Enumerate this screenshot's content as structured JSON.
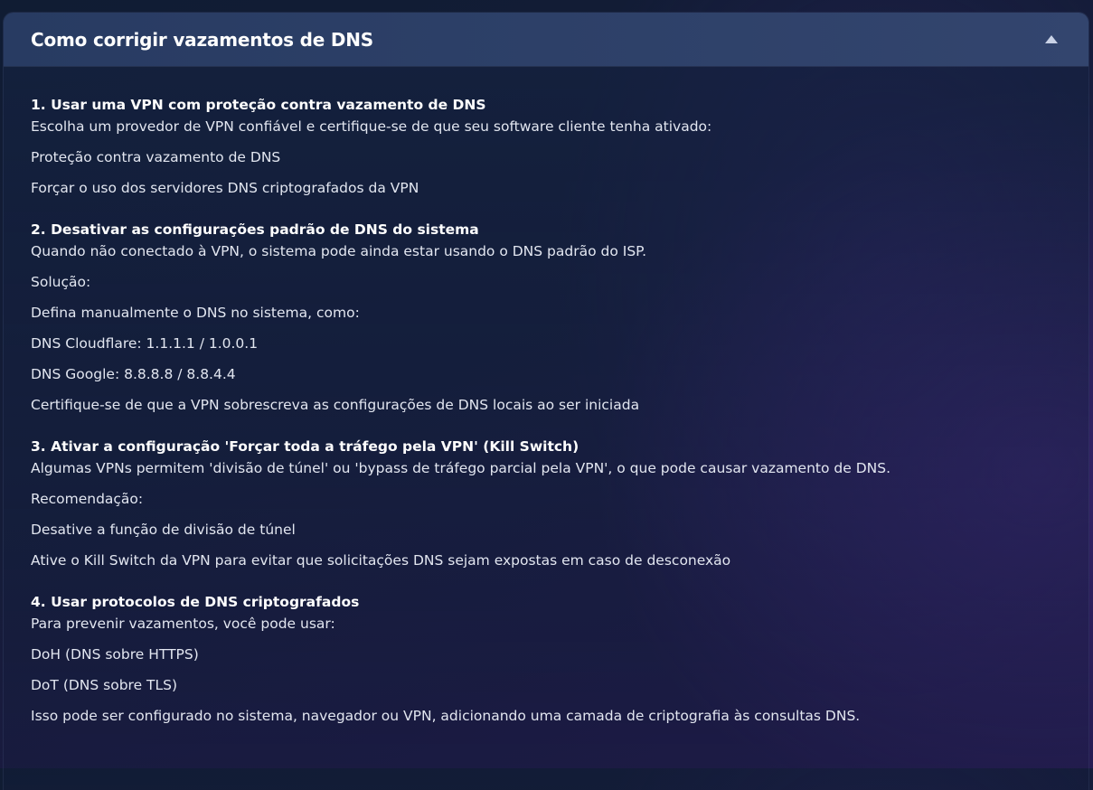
{
  "panel": {
    "title": "Como corrigir vazamentos de DNS"
  },
  "sections": [
    {
      "title": "1. Usar uma VPN com proteção contra vazamento de DNS",
      "lines": [
        "Escolha um provedor de VPN confiável e certifique-se de que seu software cliente tenha ativado:",
        "Proteção contra vazamento de DNS",
        "Forçar o uso dos servidores DNS criptografados da VPN"
      ]
    },
    {
      "title": "2. Desativar as configurações padrão de DNS do sistema",
      "lines": [
        "Quando não conectado à VPN, o sistema pode ainda estar usando o DNS padrão do ISP.",
        "Solução:",
        "Defina manualmente o DNS no sistema, como:",
        "DNS Cloudflare: 1.1.1.1 / 1.0.0.1",
        "DNS Google: 8.8.8.8 / 8.8.4.4",
        "Certifique-se de que a VPN sobrescreva as configurações de DNS locais ao ser iniciada"
      ]
    },
    {
      "title": "3. Ativar a configuração 'Forçar toda a tráfego pela VPN' (Kill Switch)",
      "lines": [
        "Algumas VPNs permitem 'divisão de túnel' ou 'bypass de tráfego parcial pela VPN', o que pode causar vazamento de DNS.",
        "Recomendação:",
        "Desative a função de divisão de túnel",
        "Ative o Kill Switch da VPN para evitar que solicitações DNS sejam expostas em caso de desconexão"
      ]
    },
    {
      "title": "4. Usar protocolos de DNS criptografados",
      "lines": [
        "Para prevenir vazamentos, você pode usar:",
        "DoH (DNS sobre HTTPS)",
        "DoT (DNS sobre TLS)",
        "Isso pode ser configurado no sistema, navegador ou VPN, adicionando uma camada de criptografia às consultas DNS."
      ]
    }
  ]
}
